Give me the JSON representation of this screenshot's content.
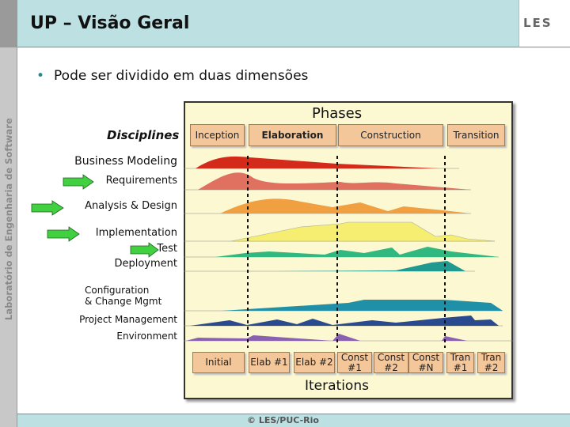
{
  "slide": {
    "title": "UP – Visão Geral",
    "sidebar_text": "Laboratório de Engenharia de Software",
    "logo": "LES",
    "bullet": "Pode ser dividido em duas dimensões",
    "footer": "© LES/PUC-Rio"
  },
  "diagram": {
    "phases_title": "Phases",
    "phases": [
      "Inception",
      "Elaboration",
      "Construction",
      "Transition"
    ],
    "disciplines_title": "Disciplines",
    "disciplines": [
      "Business Modeling",
      "Requirements",
      "Analysis & Design",
      "Implementation",
      "Test",
      "Deployment",
      "Configuration\n& Change Mgmt",
      "Project Management",
      "Environment"
    ],
    "highlighted_disciplines": [
      "Requirements",
      "Analysis & Design",
      "Implementation",
      "Test"
    ],
    "iterations_title": "Iterations",
    "iterations": [
      "Initial",
      "Elab #1",
      "Elab #2",
      "Const\n#1",
      "Const\n#2",
      "Const\n#N",
      "Tran\n#1",
      "Tran\n#2"
    ],
    "colors": {
      "business_modeling": "#d42a1a",
      "requirements": "#e07060",
      "analysis_design": "#f0a040",
      "implementation": "#f5ee70",
      "test": "#30b880",
      "deployment": "#209a90",
      "configuration": "#2090a8",
      "project_management": "#2a4a90",
      "environment": "#8a60b0",
      "arrow": "#40d040"
    }
  }
}
